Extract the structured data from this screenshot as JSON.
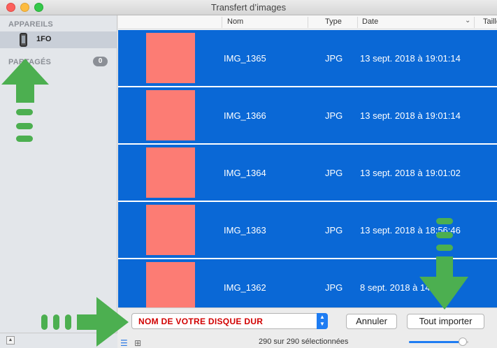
{
  "window": {
    "title": "Transfert d’images"
  },
  "sidebar": {
    "devices_header": "APPAREILS",
    "device_name": "1FO",
    "shared_header": "PARTAGÉS",
    "shared_count": "0"
  },
  "columns": {
    "name": "Nom",
    "type": "Type",
    "date": "Date",
    "size": "Taille"
  },
  "rows": [
    {
      "name": "IMG_1365",
      "type": "JPG",
      "date": "13 sept. 2018 à 19:01:14"
    },
    {
      "name": "IMG_1366",
      "type": "JPG",
      "date": "13 sept. 2018 à 19:01:14"
    },
    {
      "name": "IMG_1364",
      "type": "JPG",
      "date": "13 sept. 2018 à 19:01:02"
    },
    {
      "name": "IMG_1363",
      "type": "JPG",
      "date": "13 sept. 2018 à 18:56:46"
    },
    {
      "name": "IMG_1362",
      "type": "JPG",
      "date": "8 sept. 2018 à 14:25:50"
    }
  ],
  "footer": {
    "destination": "NOM DE VOTRE DISQUE DUR",
    "cancel_label": "Annuler",
    "import_all_label": "Tout importer",
    "status": "290 sur 290 sélectionnées",
    "zoom_level": 0.9
  },
  "colors": {
    "selection": "#0a68d6",
    "thumbnail": "#fc7c74",
    "arrows": "#4caf50",
    "destination_text": "#d10000"
  },
  "icons": [
    "phone-icon",
    "eject-icon",
    "list-view-icon",
    "grid-view-icon",
    "updown-chevron-icon"
  ]
}
